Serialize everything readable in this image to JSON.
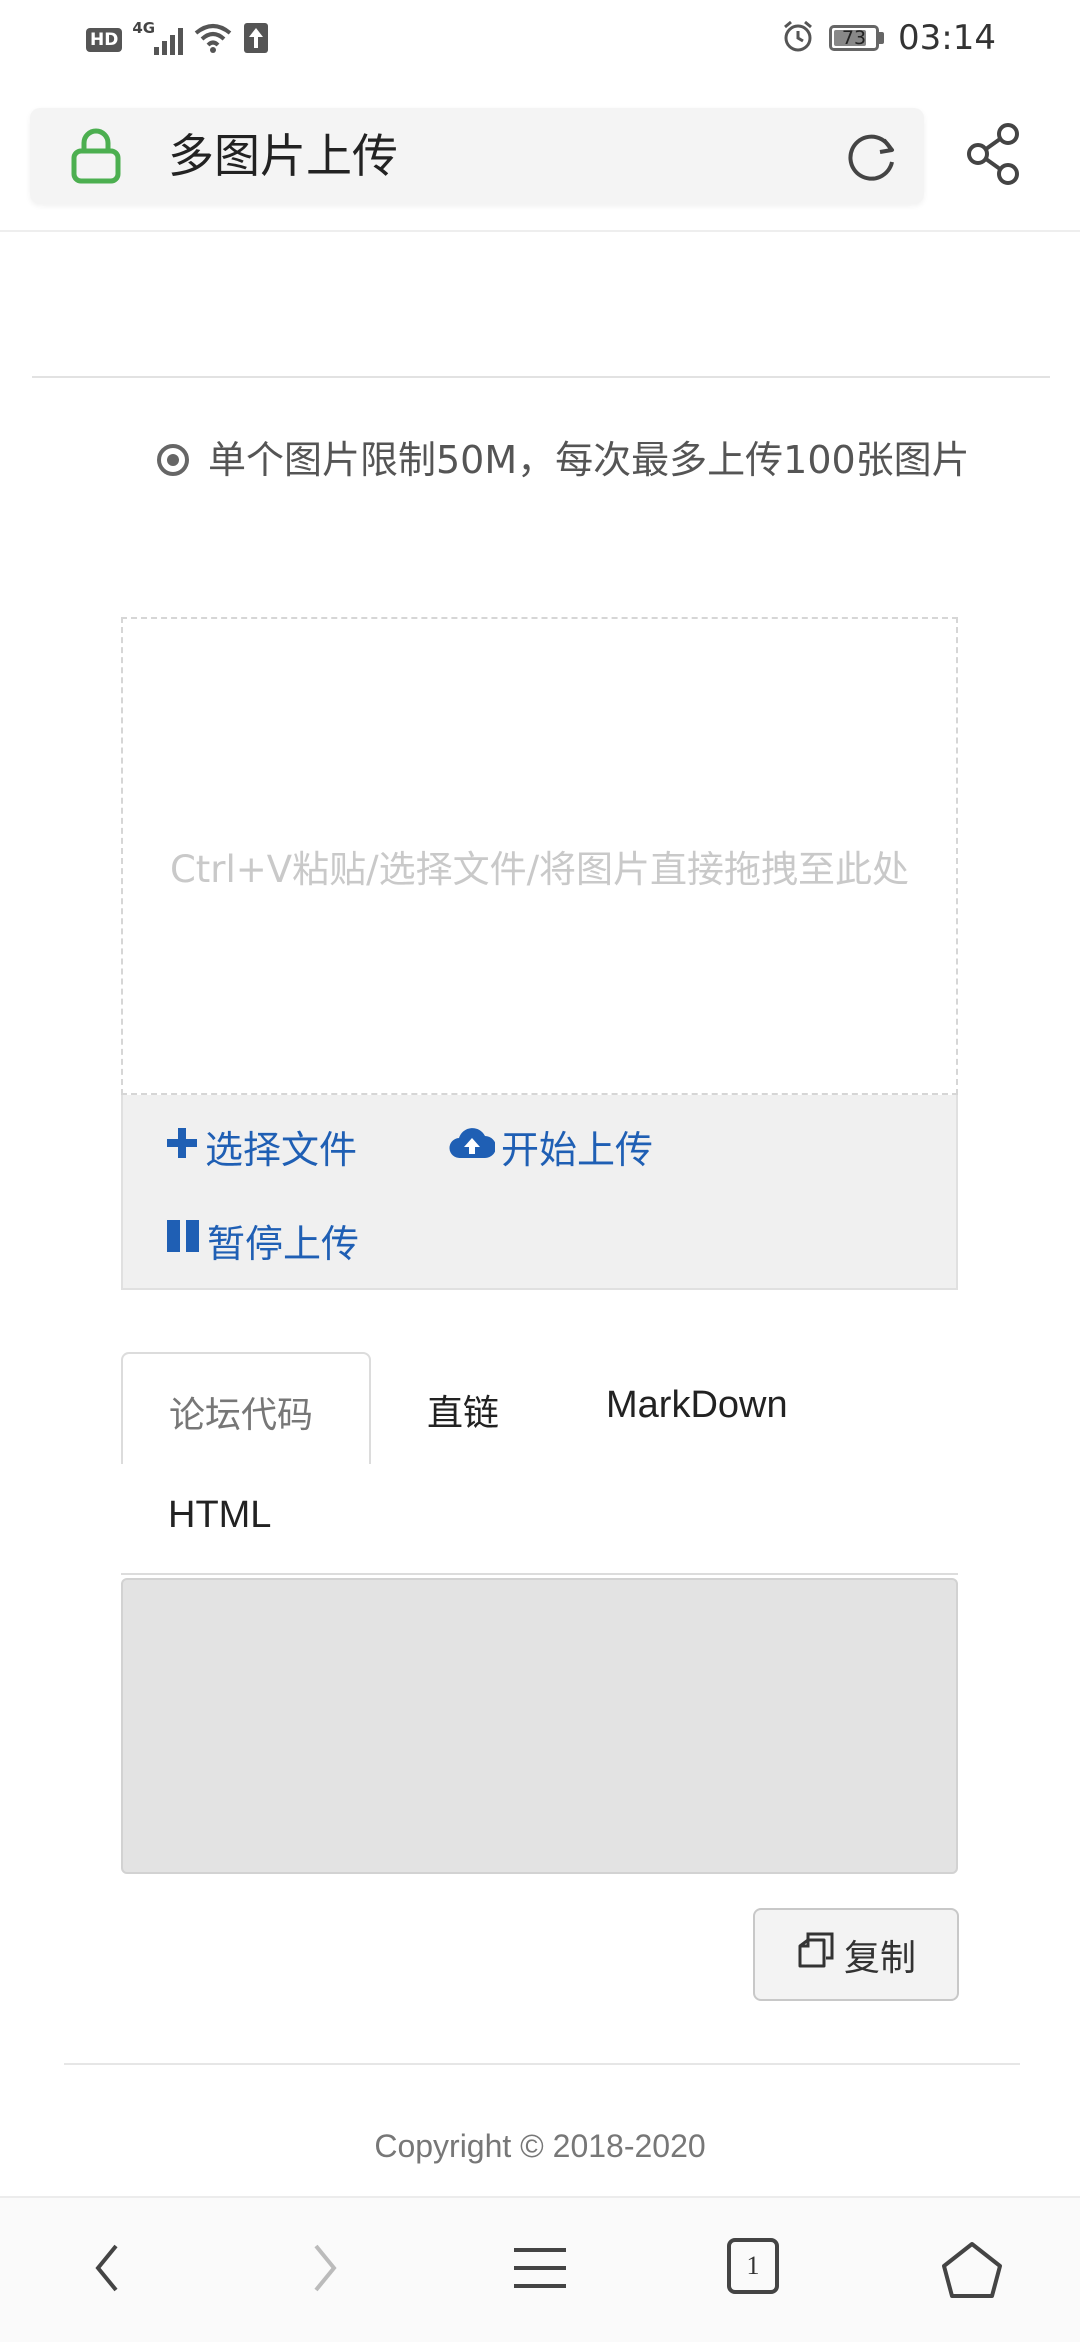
{
  "status_bar": {
    "hd": "HD",
    "network": "4G",
    "battery": "73",
    "time": "03:14"
  },
  "address_bar": {
    "title": "多图片上传"
  },
  "notice": {
    "text": "单个图片限制50M，每次最多上传100张图片"
  },
  "uploader": {
    "drop_hint": "Ctrl+V粘贴/选择文件/将图片直接拖拽至此处",
    "select_files": "选择文件",
    "start_upload": "开始上传",
    "pause_upload": "暂停上传"
  },
  "tabs": [
    {
      "label": "论坛代码",
      "active": true
    },
    {
      "label": "直链",
      "active": false
    },
    {
      "label": "MarkDown",
      "active": false
    },
    {
      "label": "HTML",
      "active": false
    }
  ],
  "output": {
    "value": ""
  },
  "copy_button": {
    "label": "复制"
  },
  "footer": {
    "copyright": "Copyright © 2018-2020"
  },
  "bottom_nav": {
    "tab_count": "1"
  },
  "colors": {
    "accent_blue": "#1f5fb4",
    "lock_green": "#4caf50"
  }
}
